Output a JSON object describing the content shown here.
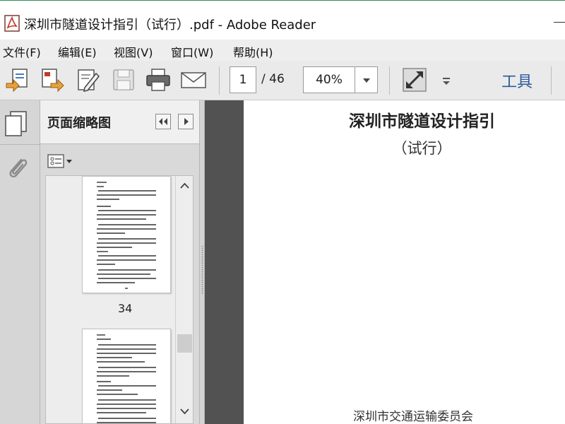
{
  "window": {
    "title": "深圳市隧道设计指引（试行）.pdf - Adobe Reader"
  },
  "menu": {
    "items": [
      "文件(F)",
      "编辑(E)",
      "视图(V)",
      "窗口(W)",
      "帮助(H)"
    ]
  },
  "toolbar": {
    "current_page": "1",
    "total_pages": "/ 46",
    "zoom": "40%",
    "tools_label": "工具",
    "icons": [
      "create-pdf-icon",
      "export-icon",
      "edit-icon",
      "save-icon",
      "print-icon",
      "email-icon",
      "fullscreen-icon",
      "more-icon"
    ]
  },
  "thumbnails": {
    "panel_title": "页面缩略图",
    "page_labels": [
      "34"
    ]
  },
  "document": {
    "title": "深圳市隧道设计指引",
    "subtitle": "（试行）",
    "footer": "深圳市交通运输委员会"
  },
  "colors": {
    "accent": "#2b5a9e",
    "doc_background": "#525252",
    "pdf_red": "#c0392b"
  }
}
